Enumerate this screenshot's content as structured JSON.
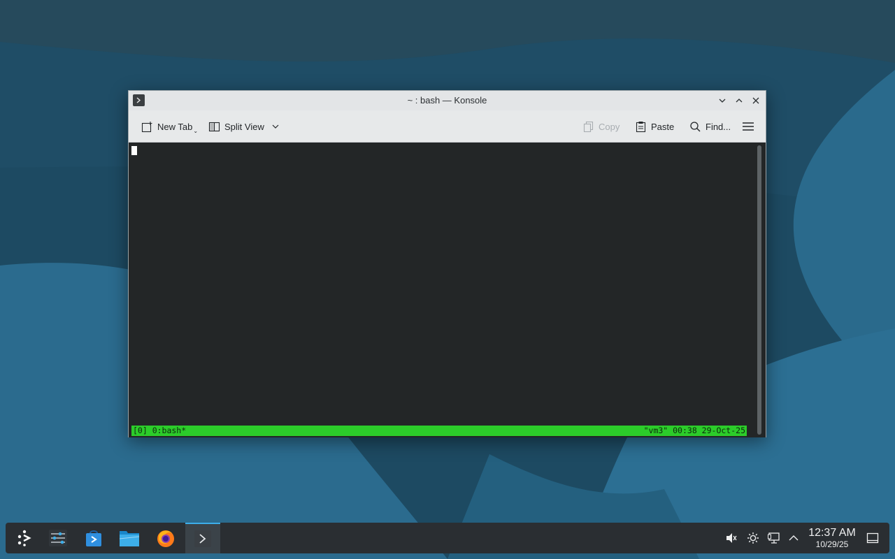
{
  "window": {
    "title": "~ : bash — Konsole"
  },
  "toolbar": {
    "new_tab_label": "New Tab",
    "split_view_label": "Split View",
    "copy_label": "Copy",
    "paste_label": "Paste",
    "find_label": "Find..."
  },
  "terminal": {
    "tmux_left": "[0] 0:bash*",
    "tmux_right": "\"vm3\" 00:38 29-Oct-25",
    "tmux_color": "#2ccc2a",
    "background_color": "#232627"
  },
  "taskbar": {
    "items": [
      {
        "name": "application-launcher-icon"
      },
      {
        "name": "system-settings-icon"
      },
      {
        "name": "discover-store-icon"
      },
      {
        "name": "file-manager-icon"
      },
      {
        "name": "firefox-icon"
      },
      {
        "name": "konsole-icon",
        "active": true
      }
    ],
    "clock_time": "12:37 AM",
    "clock_date": "10/29/25",
    "accent_color": "#3daee9"
  }
}
